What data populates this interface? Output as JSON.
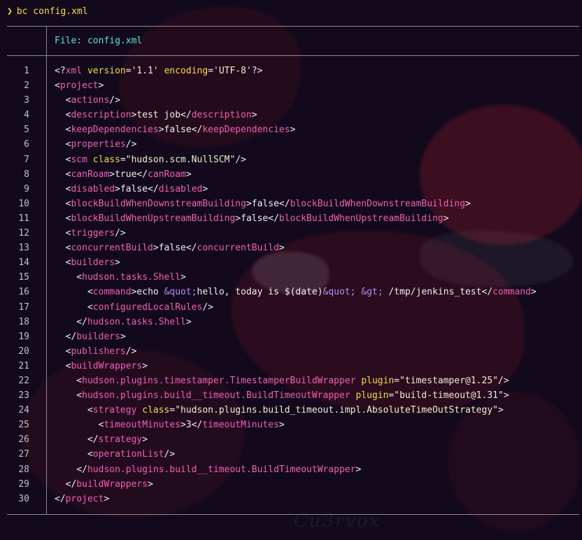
{
  "terminal": {
    "prompt_symbol": "❯",
    "command": "bc config.xml",
    "file_header": "File: config.xml"
  },
  "file": {
    "lines": [
      [
        {
          "t": "p",
          "v": "<?"
        },
        {
          "t": "tag",
          "v": "xml"
        },
        {
          "t": "p",
          "v": " "
        },
        {
          "t": "attr",
          "v": "version"
        },
        {
          "t": "p",
          "v": "="
        },
        {
          "t": "str",
          "v": "'1.1'"
        },
        {
          "t": "p",
          "v": " "
        },
        {
          "t": "attr",
          "v": "encoding"
        },
        {
          "t": "p",
          "v": "="
        },
        {
          "t": "str",
          "v": "'UTF-8'"
        },
        {
          "t": "p",
          "v": "?>"
        }
      ],
      [
        {
          "t": "p",
          "v": "<"
        },
        {
          "t": "tag",
          "v": "project"
        },
        {
          "t": "p",
          "v": ">"
        }
      ],
      [
        {
          "t": "p",
          "v": "  <"
        },
        {
          "t": "tag",
          "v": "actions"
        },
        {
          "t": "p",
          "v": "/>"
        }
      ],
      [
        {
          "t": "p",
          "v": "  <"
        },
        {
          "t": "tag",
          "v": "description"
        },
        {
          "t": "p",
          "v": ">"
        },
        {
          "t": "txt",
          "v": "test job"
        },
        {
          "t": "p",
          "v": "</"
        },
        {
          "t": "tag",
          "v": "description"
        },
        {
          "t": "p",
          "v": ">"
        }
      ],
      [
        {
          "t": "p",
          "v": "  <"
        },
        {
          "t": "tag",
          "v": "keepDependencies"
        },
        {
          "t": "p",
          "v": ">"
        },
        {
          "t": "txt",
          "v": "false"
        },
        {
          "t": "p",
          "v": "</"
        },
        {
          "t": "tag",
          "v": "keepDependencies"
        },
        {
          "t": "p",
          "v": ">"
        }
      ],
      [
        {
          "t": "p",
          "v": "  <"
        },
        {
          "t": "tag",
          "v": "properties"
        },
        {
          "t": "p",
          "v": "/>"
        }
      ],
      [
        {
          "t": "p",
          "v": "  <"
        },
        {
          "t": "tag",
          "v": "scm"
        },
        {
          "t": "p",
          "v": " "
        },
        {
          "t": "attr",
          "v": "class"
        },
        {
          "t": "p",
          "v": "="
        },
        {
          "t": "str",
          "v": "\"hudson.scm.NullSCM\""
        },
        {
          "t": "p",
          "v": "/>"
        }
      ],
      [
        {
          "t": "p",
          "v": "  <"
        },
        {
          "t": "tag",
          "v": "canRoam"
        },
        {
          "t": "p",
          "v": ">"
        },
        {
          "t": "txt",
          "v": "true"
        },
        {
          "t": "p",
          "v": "</"
        },
        {
          "t": "tag",
          "v": "canRoam"
        },
        {
          "t": "p",
          "v": ">"
        }
      ],
      [
        {
          "t": "p",
          "v": "  <"
        },
        {
          "t": "tag",
          "v": "disabled"
        },
        {
          "t": "p",
          "v": ">"
        },
        {
          "t": "txt",
          "v": "false"
        },
        {
          "t": "p",
          "v": "</"
        },
        {
          "t": "tag",
          "v": "disabled"
        },
        {
          "t": "p",
          "v": ">"
        }
      ],
      [
        {
          "t": "p",
          "v": "  <"
        },
        {
          "t": "tag",
          "v": "blockBuildWhenDownstreamBuilding"
        },
        {
          "t": "p",
          "v": ">"
        },
        {
          "t": "txt",
          "v": "false"
        },
        {
          "t": "p",
          "v": "</"
        },
        {
          "t": "tag",
          "v": "blockBuildWhenDownstreamBuilding"
        },
        {
          "t": "p",
          "v": ">"
        }
      ],
      [
        {
          "t": "p",
          "v": "  <"
        },
        {
          "t": "tag",
          "v": "blockBuildWhenUpstreamBuilding"
        },
        {
          "t": "p",
          "v": ">"
        },
        {
          "t": "txt",
          "v": "false"
        },
        {
          "t": "p",
          "v": "</"
        },
        {
          "t": "tag",
          "v": "blockBuildWhenUpstreamBuilding"
        },
        {
          "t": "p",
          "v": ">"
        }
      ],
      [
        {
          "t": "p",
          "v": "  <"
        },
        {
          "t": "tag",
          "v": "triggers"
        },
        {
          "t": "p",
          "v": "/>"
        }
      ],
      [
        {
          "t": "p",
          "v": "  <"
        },
        {
          "t": "tag",
          "v": "concurrentBuild"
        },
        {
          "t": "p",
          "v": ">"
        },
        {
          "t": "txt",
          "v": "false"
        },
        {
          "t": "p",
          "v": "</"
        },
        {
          "t": "tag",
          "v": "concurrentBuild"
        },
        {
          "t": "p",
          "v": ">"
        }
      ],
      [
        {
          "t": "p",
          "v": "  <"
        },
        {
          "t": "tag",
          "v": "builders"
        },
        {
          "t": "p",
          "v": ">"
        }
      ],
      [
        {
          "t": "p",
          "v": "    <"
        },
        {
          "t": "tag",
          "v": "hudson.tasks.Shell"
        },
        {
          "t": "p",
          "v": ">"
        }
      ],
      [
        {
          "t": "p",
          "v": "      <"
        },
        {
          "t": "tag",
          "v": "command"
        },
        {
          "t": "p",
          "v": ">"
        },
        {
          "t": "txt",
          "v": "echo "
        },
        {
          "t": "ent",
          "v": "&quot;"
        },
        {
          "t": "txt",
          "v": "hello, today is $(date)"
        },
        {
          "t": "ent",
          "v": "&quot;"
        },
        {
          "t": "txt",
          "v": " "
        },
        {
          "t": "ent",
          "v": "&gt;"
        },
        {
          "t": "txt",
          "v": " /tmp/jenkins_test"
        },
        {
          "t": "p",
          "v": "</"
        },
        {
          "t": "tag",
          "v": "command"
        },
        {
          "t": "p",
          "v": ">"
        }
      ],
      [
        {
          "t": "p",
          "v": "      <"
        },
        {
          "t": "tag",
          "v": "configuredLocalRules"
        },
        {
          "t": "p",
          "v": "/>"
        }
      ],
      [
        {
          "t": "p",
          "v": "    </"
        },
        {
          "t": "tag",
          "v": "hudson.tasks.Shell"
        },
        {
          "t": "p",
          "v": ">"
        }
      ],
      [
        {
          "t": "p",
          "v": "  </"
        },
        {
          "t": "tag",
          "v": "builders"
        },
        {
          "t": "p",
          "v": ">"
        }
      ],
      [
        {
          "t": "p",
          "v": "  <"
        },
        {
          "t": "tag",
          "v": "publishers"
        },
        {
          "t": "p",
          "v": "/>"
        }
      ],
      [
        {
          "t": "p",
          "v": "  <"
        },
        {
          "t": "tag",
          "v": "buildWrappers"
        },
        {
          "t": "p",
          "v": ">"
        }
      ],
      [
        {
          "t": "p",
          "v": "    <"
        },
        {
          "t": "tag",
          "v": "hudson.plugins.timestamper.TimestamperBuildWrapper"
        },
        {
          "t": "p",
          "v": " "
        },
        {
          "t": "attr",
          "v": "plugin"
        },
        {
          "t": "p",
          "v": "="
        },
        {
          "t": "str",
          "v": "\"timestamper@1.25\""
        },
        {
          "t": "p",
          "v": "/>"
        }
      ],
      [
        {
          "t": "p",
          "v": "    <"
        },
        {
          "t": "tag",
          "v": "hudson.plugins.build__timeout.BuildTimeoutWrapper"
        },
        {
          "t": "p",
          "v": " "
        },
        {
          "t": "attr",
          "v": "plugin"
        },
        {
          "t": "p",
          "v": "="
        },
        {
          "t": "str",
          "v": "\"build-timeout@1.31\""
        },
        {
          "t": "p",
          "v": ">"
        }
      ],
      [
        {
          "t": "p",
          "v": "      <"
        },
        {
          "t": "tag",
          "v": "strategy"
        },
        {
          "t": "p",
          "v": " "
        },
        {
          "t": "attr",
          "v": "class"
        },
        {
          "t": "p",
          "v": "="
        },
        {
          "t": "str",
          "v": "\"hudson.plugins.build_timeout.impl.AbsoluteTimeOutStrategy\""
        },
        {
          "t": "p",
          "v": ">"
        }
      ],
      [
        {
          "t": "p",
          "v": "        <"
        },
        {
          "t": "tag",
          "v": "timeoutMinutes"
        },
        {
          "t": "p",
          "v": ">"
        },
        {
          "t": "txt",
          "v": "3"
        },
        {
          "t": "p",
          "v": "</"
        },
        {
          "t": "tag",
          "v": "timeoutMinutes"
        },
        {
          "t": "p",
          "v": ">"
        }
      ],
      [
        {
          "t": "p",
          "v": "      </"
        },
        {
          "t": "tag",
          "v": "strategy"
        },
        {
          "t": "p",
          "v": ">"
        }
      ],
      [
        {
          "t": "p",
          "v": "      <"
        },
        {
          "t": "tag",
          "v": "operationList"
        },
        {
          "t": "p",
          "v": "/>"
        }
      ],
      [
        {
          "t": "p",
          "v": "    </"
        },
        {
          "t": "tag",
          "v": "hudson.plugins.build__timeout.BuildTimeoutWrapper"
        },
        {
          "t": "p",
          "v": ">"
        }
      ],
      [
        {
          "t": "p",
          "v": "  </"
        },
        {
          "t": "tag",
          "v": "buildWrappers"
        },
        {
          "t": "p",
          "v": ">"
        }
      ],
      [
        {
          "t": "p",
          "v": "</"
        },
        {
          "t": "tag",
          "v": "project"
        },
        {
          "t": "p",
          "v": ">"
        }
      ]
    ]
  },
  "colors": {
    "background": "#120a1c",
    "prompt": "#ffd94a",
    "header": "#65e3d8",
    "tag": "#f25fb5",
    "attribute": "#f4dc4a",
    "string": "#f3ecd2",
    "entity": "#b58af7",
    "line_number": "#c2bfc8"
  },
  "wallpaper": {
    "watermark_text": "Cu3rvox"
  }
}
